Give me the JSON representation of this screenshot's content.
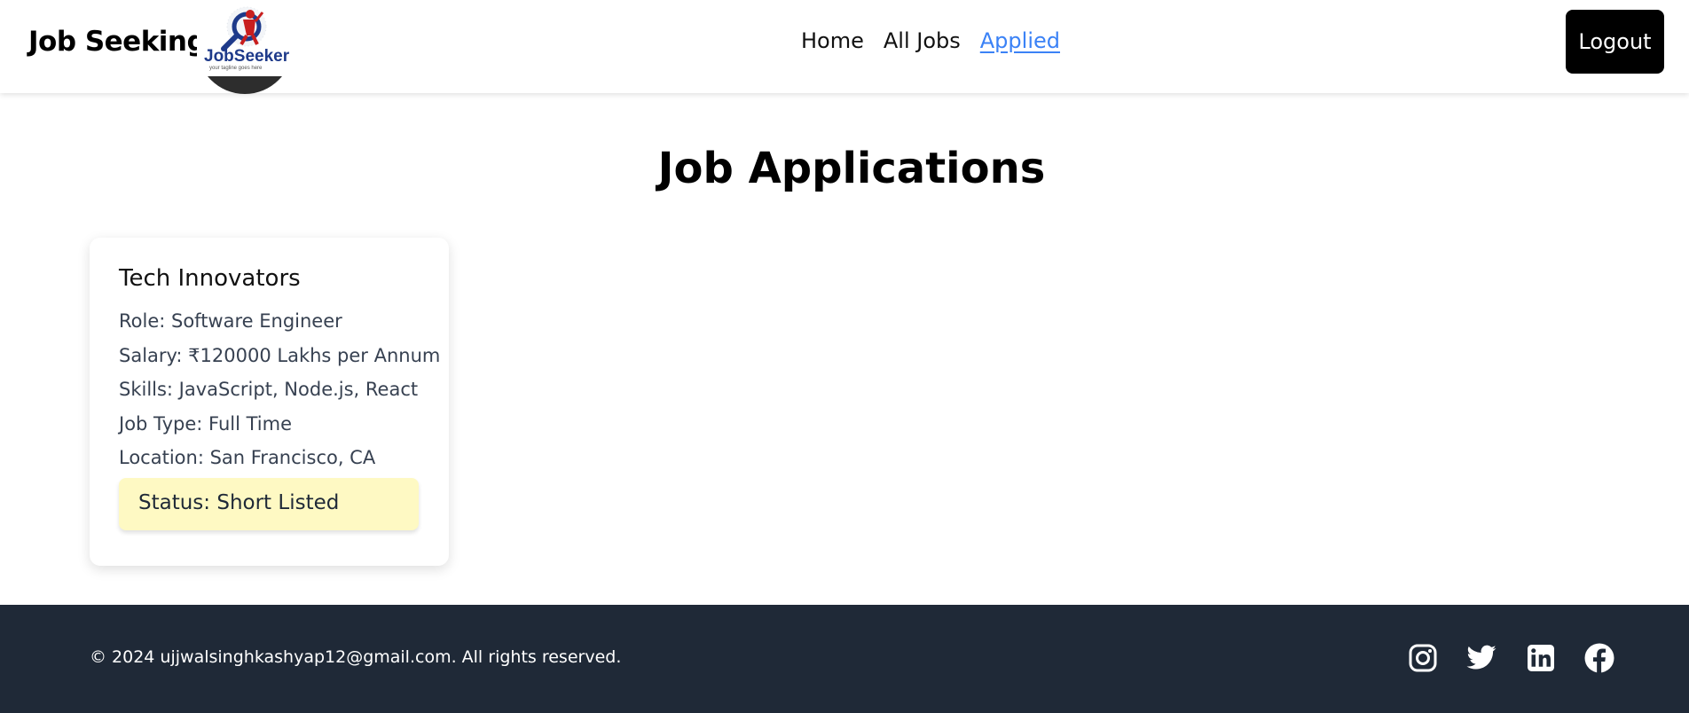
{
  "header": {
    "brand": "Job Seeking",
    "logo": {
      "text": "JobSeeker",
      "tagline": "your tagline goes here"
    },
    "nav": [
      {
        "label": "Home",
        "active": false
      },
      {
        "label": "All Jobs",
        "active": false
      },
      {
        "label": "Applied",
        "active": true
      }
    ],
    "logout_label": "Logout"
  },
  "main": {
    "title": "Job Applications",
    "applications": [
      {
        "company": "Tech Innovators",
        "role": "Role: Software Engineer",
        "salary": "Salary: ₹120000 Lakhs per Annum",
        "skills": "Skills: JavaScript, Node.js, React",
        "job_type": "Job Type: Full Time",
        "location": "Location: San Francisco, CA",
        "status": "Status: Short Listed"
      }
    ]
  },
  "footer": {
    "copyright": "© 2024 ujjwalsinghkashyap12@gmail.com. All rights reserved.",
    "social": [
      "instagram-icon",
      "twitter-icon",
      "linkedin-icon",
      "facebook-icon"
    ]
  },
  "colors": {
    "accent_link": "#3b82f6",
    "footer_bg": "#1f2937",
    "status_bg": "#fef9c3",
    "button_bg": "#000000"
  }
}
